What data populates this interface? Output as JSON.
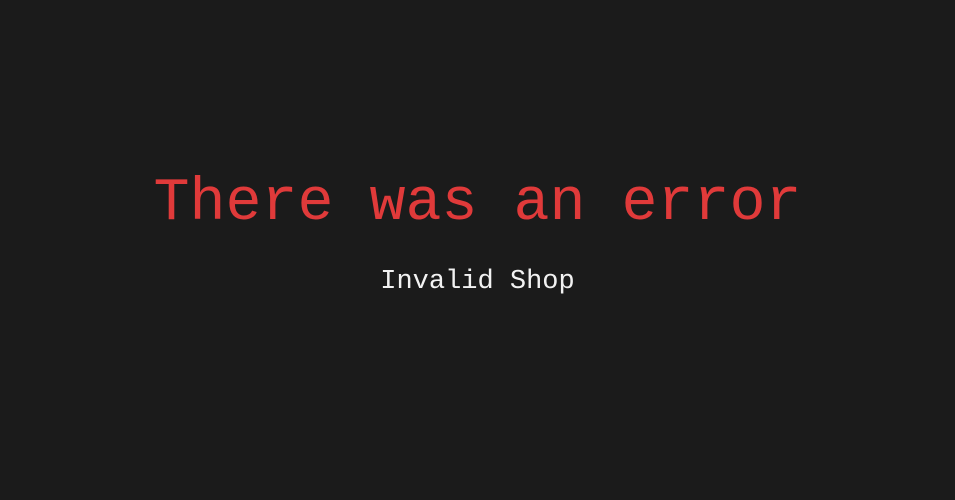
{
  "error": {
    "title": "There was an error",
    "message": "Invalid Shop"
  },
  "colors": {
    "background": "#1b1b1b",
    "title": "#e03a3a",
    "message": "#f2f2f2"
  }
}
